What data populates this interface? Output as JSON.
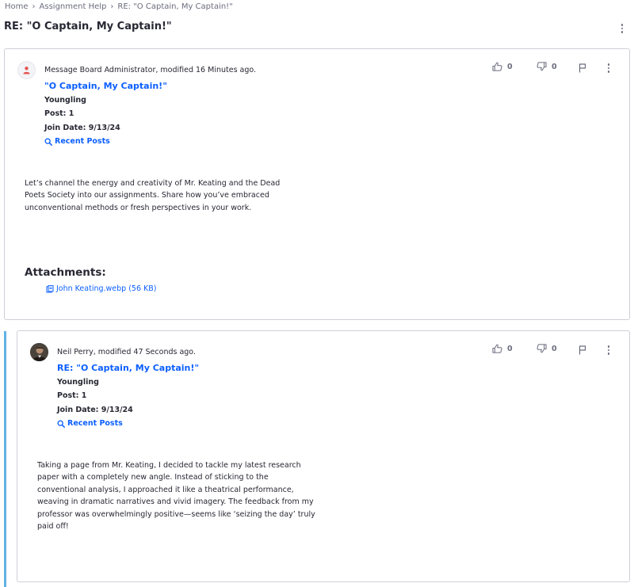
{
  "breadcrumb": {
    "items": [
      "Home",
      "Assignment Help",
      "RE: \"O Captain, My Captain!\""
    ],
    "separator": "›"
  },
  "page": {
    "title": "RE: \"O Captain, My Captain!\""
  },
  "posts": [
    {
      "author": "Message Board Administrator",
      "modified": ", modified 16 Minutes ago.",
      "subject": "\"O Captain, My Captain!\"",
      "rank": "Youngling",
      "post_count": "Post: 1",
      "join_date": "Join Date: 9/13/24",
      "recent_posts": "Recent Posts",
      "thumbs_up": "0",
      "thumbs_down": "0",
      "body_lines": [
        "Let’s channel the energy and creativity of Mr. Keating and the Dead",
        "Poets Society into our assignments. Share how you’ve embraced",
        "unconventional methods or fresh perspectives in your work."
      ],
      "attachments_title": "Attachments:",
      "attachment": "John Keating.webp (56 KB)"
    },
    {
      "author": "Neil Perry",
      "modified": ", modified 47 Seconds ago.",
      "subject": "RE: \"O Captain, My Captain!\"",
      "rank": "Youngling",
      "post_count": "Post: 1",
      "join_date": "Join Date: 9/13/24",
      "recent_posts": "Recent Posts",
      "thumbs_up": "0",
      "thumbs_down": "0",
      "body_lines": [
        "Taking a page from Mr. Keating, I decided to tackle my latest research",
        "paper with a completely new angle. Instead of sticking to the",
        "conventional analysis, I approached it like a theatrical performance,",
        "weaving in dramatic narratives and vivid imagery. The feedback from my",
        "professor was overwhelmingly positive—seems like ‘seizing the day’ truly",
        "paid off!"
      ]
    }
  ],
  "colors": {
    "link": "#0b5fff",
    "reply_bar": "#5fb2e6",
    "admin_avatar": "#e5524f"
  },
  "icons": [
    "chevron-right-icon",
    "user-icon",
    "thumbs-up-icon",
    "thumbs-down-icon",
    "flag-icon",
    "ellipsis-vertical-icon",
    "search-icon",
    "document-icon"
  ]
}
